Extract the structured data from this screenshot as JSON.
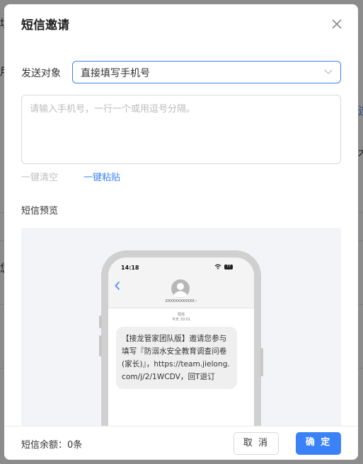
{
  "dialog": {
    "title": "短信邀请",
    "target_label": "发送对象",
    "target_value": "直接填写手机号",
    "phones_placeholder": "请输入手机号，一行一个或用逗号分隔。",
    "clear_label": "一键清空",
    "paste_label": "一键粘贴",
    "preview_label": "短信预览",
    "quota_label": "短信余额：0条",
    "cancel_label": "取 消",
    "ok_label": "确 定"
  },
  "sms_preview": {
    "time": "14:18",
    "battery": "77",
    "contact": "XXXXXXXXXXXX",
    "channel": "短信",
    "date": "今天 10:01",
    "message": "【接龙管家团队版】邀请您参与 填写『防溺水安全教育调查问卷(家长)』，https://team.jielong.com/j/2/1WCDV，回T退订"
  },
  "background": {
    "fragments": [
      "填",
      "用",
      "连",
      "木",
      "您"
    ]
  },
  "colors": {
    "accent": "#3b82f6",
    "overlay": "rgba(0,0,0,0.45)"
  },
  "icons": [
    "close-icon",
    "chevron-down-icon",
    "back-icon",
    "avatar-icon",
    "wifi-icon",
    "battery-icon"
  ]
}
